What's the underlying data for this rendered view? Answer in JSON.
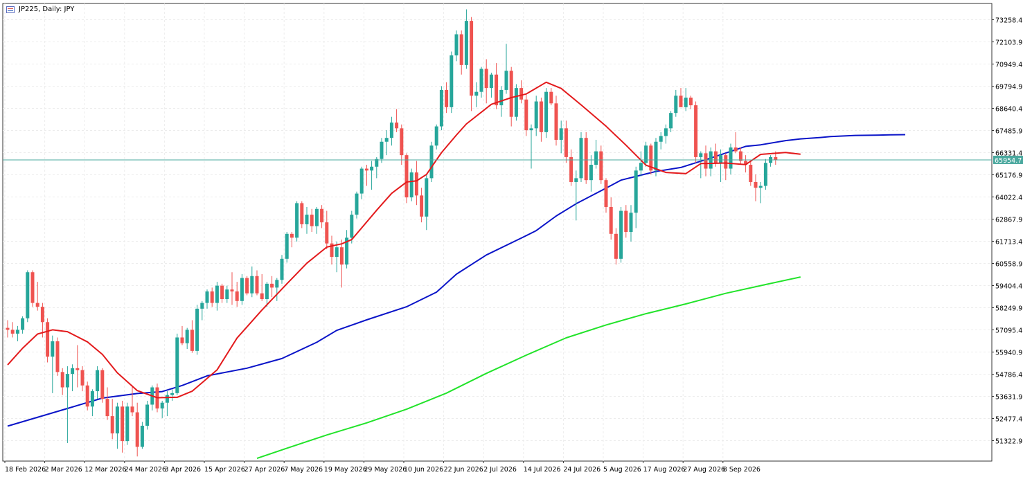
{
  "chart_data": {
    "type": "candlestick",
    "title": "JP225, Daily: JPY",
    "ylim": [
      50400,
      73800
    ],
    "y_ticks": [
      "73258.4",
      "72103.9",
      "70949.4",
      "69794.9",
      "68640.4",
      "67485.9",
      "66331.4",
      "65176.9",
      "64022.4",
      "62867.9",
      "61713.4",
      "60558.9",
      "59404.4",
      "58249.9",
      "57095.4",
      "55940.9",
      "54786.4",
      "53631.9",
      "52477.4",
      "51322.9"
    ],
    "x_tick_labels": [
      {
        "label": "18 Feb 2026",
        "bar": 0
      },
      {
        "label": "2 Mar 2026",
        "bar": 8
      },
      {
        "label": "12 Mar 2026",
        "bar": 16
      },
      {
        "label": "24 Mar 2026",
        "bar": 24
      },
      {
        "label": "3 Apr 2026",
        "bar": 32
      },
      {
        "label": "15 Apr 2026",
        "bar": 40
      },
      {
        "label": "27 Apr 2026",
        "bar": 48
      },
      {
        "label": "7 May 2026",
        "bar": 56
      },
      {
        "label": "19 May 2026",
        "bar": 64
      },
      {
        "label": "29 May 2026",
        "bar": 72
      },
      {
        "label": "10 Jun 2026",
        "bar": 80
      },
      {
        "label": "22 Jun 2026",
        "bar": 88
      },
      {
        "label": "2 Jul 2026",
        "bar": 96
      },
      {
        "label": "14 Jul 2026",
        "bar": 104
      },
      {
        "label": "24 Jul 2026",
        "bar": 112
      },
      {
        "label": "5 Aug 2026",
        "bar": 120
      },
      {
        "label": "17 Aug 2026",
        "bar": 128
      },
      {
        "label": "27 Aug 2026",
        "bar": 136
      },
      {
        "label": "8 Sep 2026",
        "bar": 144
      }
    ],
    "current_price": "65954.7",
    "current_price_value": 65954.7,
    "colors": {
      "up": "#26a69a",
      "down": "#ef5350",
      "ma_fast": "#e31a1c",
      "ma_mid": "#0a14c8",
      "ma_slow": "#22e32a",
      "price_line": "#4aa89e",
      "grid": "#ececec"
    },
    "candles": [
      [
        57200,
        57600,
        56700,
        57100
      ],
      [
        57100,
        57500,
        56700,
        56900
      ],
      [
        56900,
        57300,
        56500,
        57100
      ],
      [
        57100,
        57800,
        56900,
        57700
      ],
      [
        57700,
        60200,
        57500,
        60100
      ],
      [
        60100,
        60200,
        58300,
        58500
      ],
      [
        58500,
        59600,
        58100,
        58300
      ],
      [
        58300,
        58500,
        56700,
        57500
      ],
      [
        57500,
        57700,
        55400,
        55700
      ],
      [
        55700,
        56800,
        53800,
        56500
      ],
      [
        56500,
        56700,
        54700,
        54900
      ],
      [
        54900,
        55100,
        53700,
        54100
      ],
      [
        54100,
        55200,
        51200,
        54800
      ],
      [
        54800,
        55300,
        53900,
        55100
      ],
      [
        55100,
        56300,
        54100,
        55000
      ],
      [
        55000,
        55200,
        53900,
        54200
      ],
      [
        54200,
        54400,
        52900,
        53100
      ],
      [
        53100,
        54000,
        52600,
        53900
      ],
      [
        53900,
        55200,
        53500,
        55000
      ],
      [
        55000,
        55100,
        53300,
        53500
      ],
      [
        53500,
        54100,
        52400,
        52600
      ],
      [
        52600,
        53500,
        51400,
        51700
      ],
      [
        51700,
        53300,
        50900,
        53100
      ],
      [
        53100,
        53400,
        50700,
        51300
      ],
      [
        51300,
        53300,
        51100,
        53100
      ],
      [
        53100,
        54200,
        52600,
        52800
      ],
      [
        52800,
        53300,
        50500,
        51000
      ],
      [
        51000,
        52300,
        50900,
        52100
      ],
      [
        52100,
        53400,
        51900,
        53200
      ],
      [
        53200,
        54200,
        52900,
        54100
      ],
      [
        54100,
        54300,
        52800,
        53000
      ],
      [
        53000,
        53400,
        52500,
        53300
      ],
      [
        53300,
        53900,
        52600,
        53700
      ],
      [
        53700,
        54000,
        53400,
        53800
      ],
      [
        53800,
        56900,
        53700,
        56700
      ],
      [
        56700,
        57300,
        56300,
        56400
      ],
      [
        56400,
        57200,
        56100,
        57100
      ],
      [
        57100,
        57600,
        55900,
        56000
      ],
      [
        56000,
        58400,
        55800,
        58200
      ],
      [
        58200,
        58600,
        57600,
        58500
      ],
      [
        58500,
        59200,
        58200,
        59100
      ],
      [
        59100,
        59300,
        58300,
        58500
      ],
      [
        58500,
        59600,
        58100,
        59400
      ],
      [
        59400,
        59500,
        58500,
        58700
      ],
      [
        58700,
        59400,
        58500,
        59200
      ],
      [
        59200,
        60100,
        58400,
        59100
      ],
      [
        59100,
        59600,
        58300,
        58600
      ],
      [
        58600,
        60000,
        58400,
        59800
      ],
      [
        59800,
        59900,
        58900,
        59000
      ],
      [
        59000,
        60400,
        58800,
        59900
      ],
      [
        59900,
        60200,
        58900,
        59000
      ],
      [
        59000,
        60000,
        58600,
        58700
      ],
      [
        58700,
        59600,
        58300,
        59500
      ],
      [
        59500,
        59900,
        58800,
        59300
      ],
      [
        59300,
        59800,
        58600,
        59700
      ],
      [
        59700,
        61000,
        59500,
        60800
      ],
      [
        60800,
        62200,
        60600,
        62100
      ],
      [
        62100,
        62200,
        61400,
        61900
      ],
      [
        61900,
        63800,
        61700,
        63700
      ],
      [
        63700,
        63800,
        62400,
        62600
      ],
      [
        62600,
        63500,
        62100,
        63100
      ],
      [
        63100,
        63400,
        62200,
        62500
      ],
      [
        62500,
        63500,
        62100,
        63400
      ],
      [
        63400,
        63600,
        62400,
        62700
      ],
      [
        62700,
        63300,
        61300,
        61600
      ],
      [
        61600,
        62000,
        60500,
        60900
      ],
      [
        60900,
        61700,
        60100,
        61400
      ],
      [
        61400,
        61800,
        59300,
        60500
      ],
      [
        60500,
        62300,
        60300,
        61900
      ],
      [
        61900,
        63300,
        61600,
        63100
      ],
      [
        63100,
        64300,
        62900,
        64200
      ],
      [
        64200,
        65600,
        63900,
        65500
      ],
      [
        65500,
        65700,
        64600,
        65400
      ],
      [
        65400,
        65900,
        64400,
        65600
      ],
      [
        65600,
        66100,
        65000,
        66000
      ],
      [
        66000,
        67100,
        65800,
        66900
      ],
      [
        66900,
        67500,
        66200,
        67100
      ],
      [
        67100,
        68200,
        66700,
        67900
      ],
      [
        67900,
        68600,
        67400,
        67600
      ],
      [
        67600,
        67800,
        65700,
        66200
      ],
      [
        66200,
        66300,
        63700,
        64000
      ],
      [
        64000,
        65500,
        63800,
        65300
      ],
      [
        65300,
        65900,
        63600,
        64100
      ],
      [
        64100,
        64500,
        62700,
        63000
      ],
      [
        63000,
        65200,
        62300,
        65000
      ],
      [
        65000,
        66900,
        64800,
        66700
      ],
      [
        66700,
        67800,
        66500,
        67700
      ],
      [
        67700,
        69800,
        67500,
        69600
      ],
      [
        69600,
        70000,
        68400,
        68700
      ],
      [
        68700,
        71600,
        68400,
        71400
      ],
      [
        71400,
        72700,
        71100,
        72500
      ],
      [
        72500,
        72700,
        70400,
        70900
      ],
      [
        70900,
        73800,
        70700,
        73200
      ],
      [
        73200,
        73400,
        68500,
        69300
      ],
      [
        69300,
        70000,
        68700,
        69500
      ],
      [
        69500,
        70800,
        69200,
        70700
      ],
      [
        70700,
        71200,
        68900,
        69700
      ],
      [
        69700,
        70500,
        69200,
        70400
      ],
      [
        70400,
        71000,
        68600,
        68800
      ],
      [
        68800,
        69800,
        68200,
        69600
      ],
      [
        69600,
        72000,
        69400,
        70600
      ],
      [
        70600,
        70800,
        67700,
        68200
      ],
      [
        68200,
        69900,
        68000,
        69700
      ],
      [
        69700,
        70100,
        68900,
        69100
      ],
      [
        69100,
        69400,
        67200,
        67500
      ],
      [
        67500,
        67800,
        65500,
        67600
      ],
      [
        67600,
        69300,
        67200,
        69000
      ],
      [
        69000,
        69200,
        66900,
        67400
      ],
      [
        67400,
        69700,
        67100,
        69500
      ],
      [
        69500,
        69700,
        68800,
        68900
      ],
      [
        68900,
        69300,
        66700,
        67000
      ],
      [
        67000,
        68000,
        66300,
        67600
      ],
      [
        67600,
        68000,
        65800,
        66100
      ],
      [
        66100,
        66500,
        64600,
        64800
      ],
      [
        64800,
        65400,
        62800,
        65000
      ],
      [
        65000,
        67400,
        64800,
        67100
      ],
      [
        67100,
        67400,
        64700,
        64900
      ],
      [
        64900,
        66200,
        64300,
        65700
      ],
      [
        65700,
        67000,
        65500,
        66400
      ],
      [
        66400,
        66700,
        64700,
        64900
      ],
      [
        64900,
        65000,
        63200,
        63500
      ],
      [
        63500,
        64000,
        61800,
        62100
      ],
      [
        62100,
        62400,
        60500,
        60800
      ],
      [
        60800,
        63500,
        60600,
        63300
      ],
      [
        63300,
        63600,
        61900,
        62200
      ],
      [
        62200,
        63600,
        61700,
        63200
      ],
      [
        63200,
        65600,
        62400,
        65400
      ],
      [
        65400,
        66400,
        65100,
        65800
      ],
      [
        65800,
        66900,
        65600,
        66700
      ],
      [
        66700,
        66800,
        65200,
        65400
      ],
      [
        65400,
        67100,
        65100,
        66900
      ],
      [
        66900,
        67400,
        66500,
        67200
      ],
      [
        67200,
        67800,
        66800,
        67600
      ],
      [
        67600,
        68500,
        67400,
        68400
      ],
      [
        68400,
        69600,
        68200,
        69300
      ],
      [
        69300,
        69700,
        68800,
        68700
      ],
      [
        68700,
        69700,
        68500,
        69200
      ],
      [
        69200,
        69300,
        68600,
        68800
      ],
      [
        68800,
        69000,
        65800,
        66100
      ],
      [
        66100,
        66400,
        65000,
        66300
      ],
      [
        66300,
        66700,
        65100,
        65500
      ],
      [
        65500,
        66600,
        65100,
        66400
      ],
      [
        66400,
        66800,
        65600,
        65800
      ],
      [
        65800,
        66500,
        64800,
        66200
      ],
      [
        66200,
        66300,
        64900,
        65500
      ],
      [
        65500,
        66800,
        65200,
        66600
      ],
      [
        66600,
        67400,
        66300,
        66400
      ],
      [
        66400,
        66600,
        65700,
        65900
      ],
      [
        65900,
        66200,
        65300,
        65700
      ],
      [
        65700,
        65900,
        64600,
        64800
      ],
      [
        64800,
        65200,
        63800,
        64500
      ],
      [
        64500,
        64800,
        63700,
        64600
      ],
      [
        64600,
        66000,
        64400,
        65800
      ],
      [
        65800,
        66200,
        65600,
        66100
      ],
      [
        66100,
        66400,
        65700,
        65950
      ]
    ],
    "series": [
      {
        "color": "#0a14c8",
        "values": [
          [
            0,
            52080
          ],
          [
            12,
            53000
          ],
          [
            19,
            53540
          ],
          [
            26,
            53780
          ],
          [
            31,
            53880
          ],
          [
            35,
            54200
          ],
          [
            40,
            54700
          ],
          [
            48,
            55100
          ],
          [
            55,
            55600
          ],
          [
            62,
            56450
          ],
          [
            66,
            57070
          ],
          [
            72,
            57620
          ],
          [
            80,
            58300
          ],
          [
            86,
            59060
          ],
          [
            90,
            60000
          ],
          [
            96,
            61000
          ],
          [
            103,
            61880
          ],
          [
            106,
            62270
          ],
          [
            110,
            63030
          ],
          [
            114,
            63670
          ],
          [
            120,
            64480
          ],
          [
            123,
            64900
          ],
          [
            127,
            65160
          ],
          [
            130,
            65350
          ],
          [
            135,
            65560
          ],
          [
            141,
            66050
          ],
          [
            148,
            66660
          ],
          [
            151,
            66740
          ],
          [
            156,
            66960
          ],
          [
            159,
            67050
          ],
          [
            163,
            67120
          ],
          [
            165,
            67170
          ],
          [
            170,
            67230
          ],
          [
            174,
            67240
          ],
          [
            177,
            67260
          ],
          [
            180,
            67270
          ]
        ]
      },
      {
        "color": "#e31a1c",
        "values": [
          [
            0,
            55270
          ],
          [
            3,
            56140
          ],
          [
            6,
            56880
          ],
          [
            9,
            57100
          ],
          [
            12,
            57000
          ],
          [
            16,
            56470
          ],
          [
            19,
            55820
          ],
          [
            22,
            54860
          ],
          [
            26,
            53930
          ],
          [
            30,
            53560
          ],
          [
            34,
            53580
          ],
          [
            37,
            53900
          ],
          [
            42,
            55010
          ],
          [
            46,
            56670
          ],
          [
            51,
            58130
          ],
          [
            56,
            59500
          ],
          [
            60,
            60570
          ],
          [
            64,
            61410
          ],
          [
            67,
            61580
          ],
          [
            69,
            61800
          ],
          [
            74,
            63330
          ],
          [
            77,
            64210
          ],
          [
            80,
            64800
          ],
          [
            82,
            64860
          ],
          [
            84,
            65200
          ],
          [
            87,
            66330
          ],
          [
            90,
            67250
          ],
          [
            92,
            67830
          ],
          [
            97,
            68850
          ],
          [
            101,
            69200
          ],
          [
            104,
            69390
          ],
          [
            108,
            70000
          ],
          [
            111,
            69680
          ],
          [
            115,
            68820
          ],
          [
            120,
            67710
          ],
          [
            124,
            66720
          ],
          [
            128,
            65680
          ],
          [
            132,
            65300
          ],
          [
            136,
            65240
          ],
          [
            139,
            65760
          ],
          [
            144,
            65790
          ],
          [
            148,
            65710
          ],
          [
            151,
            66240
          ],
          [
            156,
            66340
          ],
          [
            159,
            66250
          ]
        ]
      },
      {
        "color": "#22e32a",
        "values": [
          [
            50,
            50400
          ],
          [
            56,
            50930
          ],
          [
            64,
            51620
          ],
          [
            72,
            52250
          ],
          [
            80,
            52960
          ],
          [
            88,
            53800
          ],
          [
            96,
            54830
          ],
          [
            104,
            55780
          ],
          [
            112,
            56680
          ],
          [
            120,
            57350
          ],
          [
            128,
            57940
          ],
          [
            136,
            58450
          ],
          [
            144,
            59000
          ],
          [
            152,
            59460
          ],
          [
            159,
            59850
          ]
        ]
      }
    ]
  }
}
